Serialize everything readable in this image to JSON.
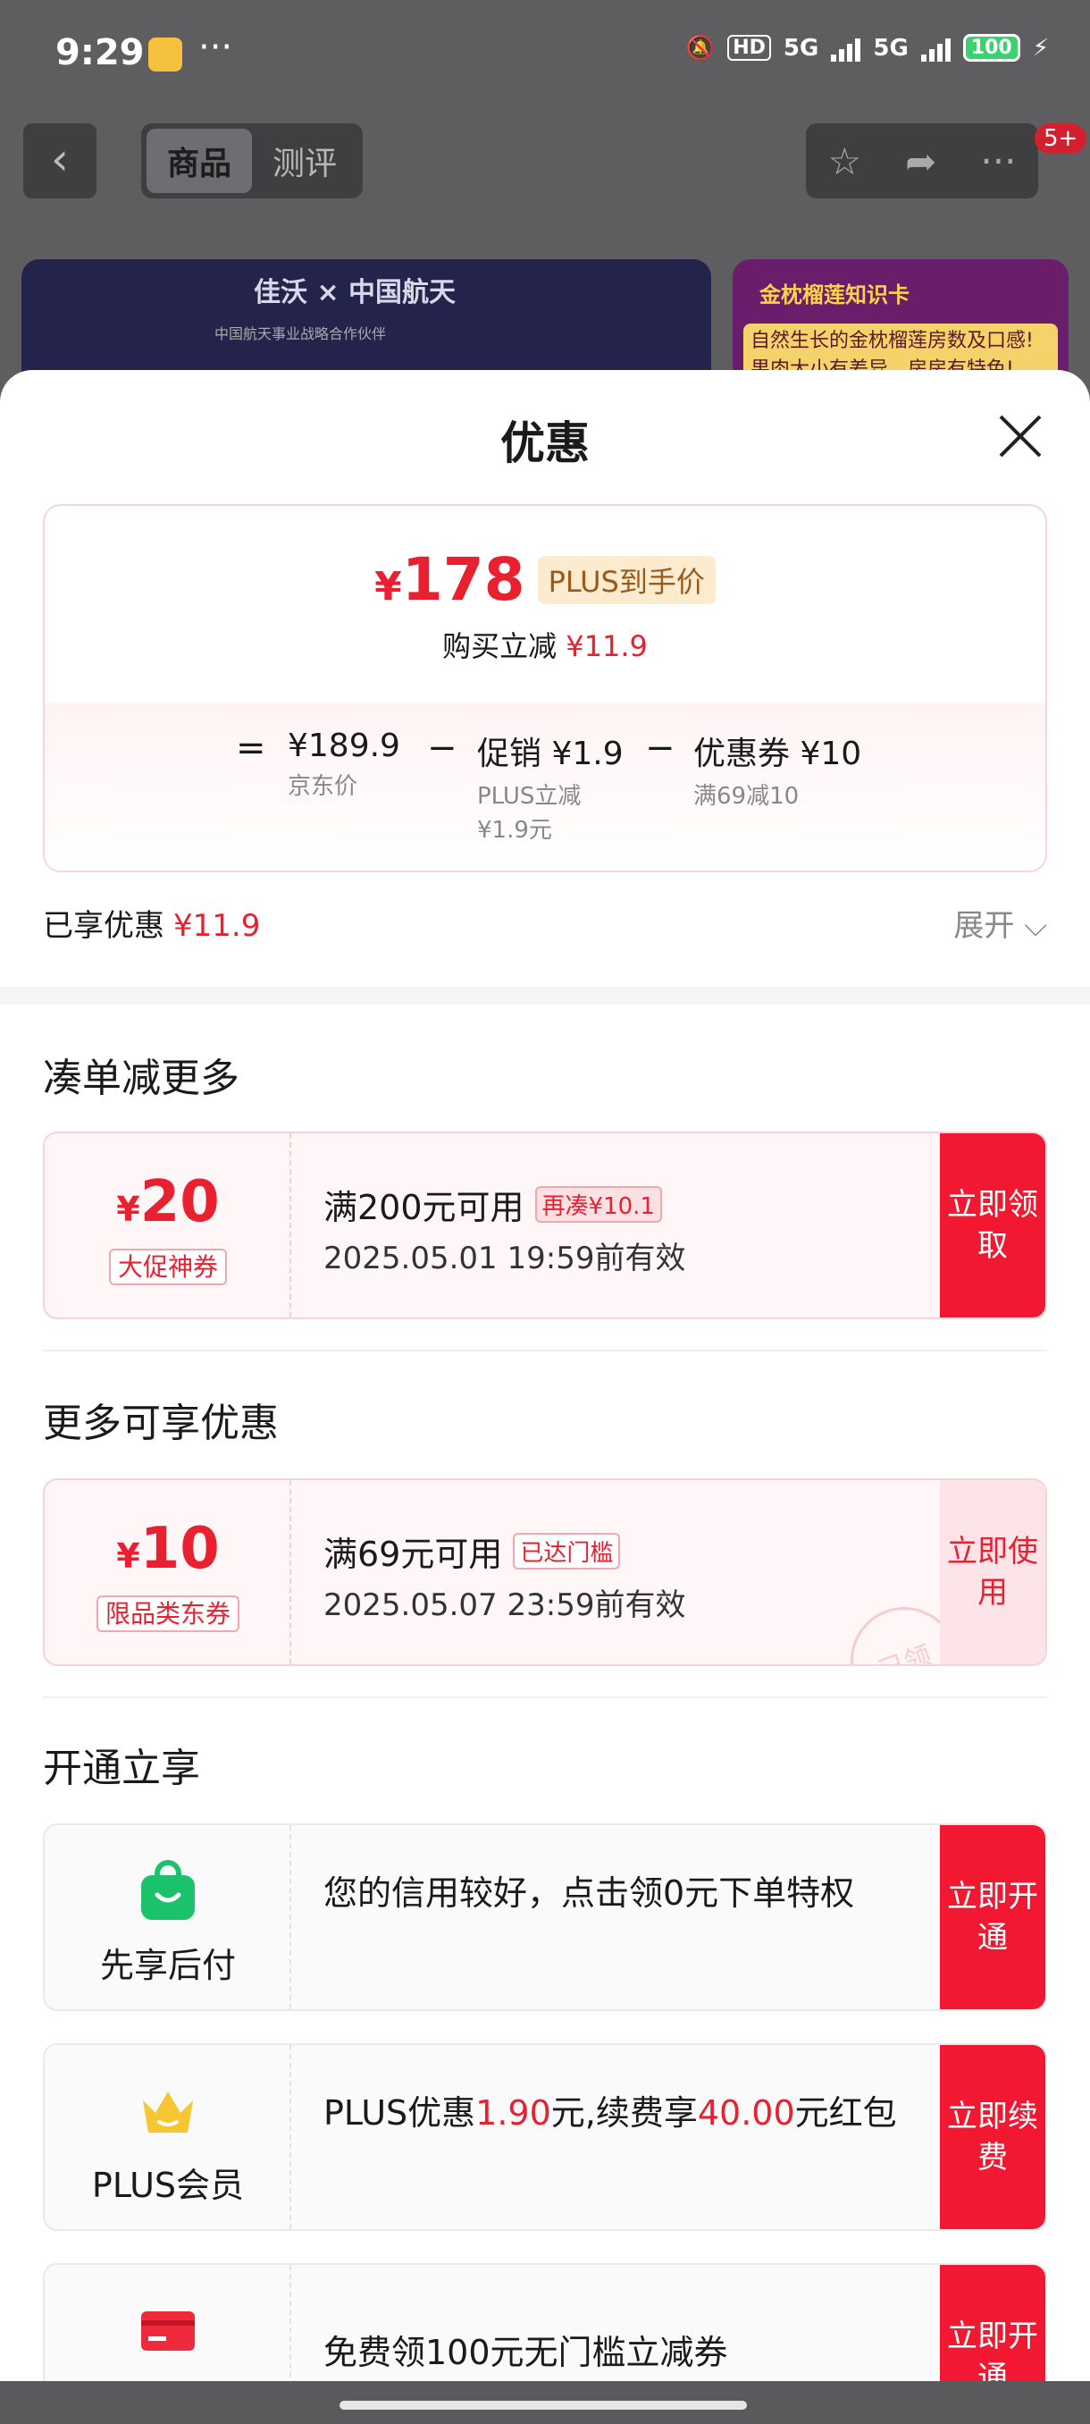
{
  "status_bar": {
    "time": "9:29",
    "dots": "···",
    "hd": "HD",
    "network1": "5G",
    "network2": "5G",
    "battery": "100"
  },
  "nav": {
    "back_icon": "‹",
    "tabs": [
      "商品",
      "测评"
    ],
    "active_tab": 0,
    "badge": "5+"
  },
  "banner_left": {
    "title": "佳沃 × 中国航天",
    "subtitle": "中国航天事业战略合作伙伴"
  },
  "banner_right": {
    "title": "金枕榴莲知识卡",
    "text": "自然生长的金枕榴莲房数及口感!果肉大小有差异、房房有特色!"
  },
  "sheet": {
    "title": "优惠",
    "price": {
      "yen": "¥",
      "value": "178",
      "tag": "PLUS到手价",
      "reduce_label": "购买立减",
      "reduce_value": "¥11.9"
    },
    "breakdown": {
      "eq": "=",
      "jd_price": "¥189.9",
      "jd_label": "京东价",
      "minus1": "−",
      "promo": "促销 ¥1.9",
      "promo_sub": "PLUS立减¥1.9元",
      "minus2": "−",
      "coupon": "优惠券 ¥10",
      "coupon_sub": "满69减10"
    },
    "enjoyed_label": "已享优惠",
    "enjoyed_value": "¥11.9",
    "expand_label": "展开 ⌵",
    "section1": "凑单减更多",
    "coupon1": {
      "yen": "¥",
      "amount": "20",
      "tag": "大促神券",
      "condition": "满200元可用",
      "cond_tag": "再凑¥10.1",
      "expire": "2025.05.01 19:59前有效",
      "action": "立即领取"
    },
    "section2": "更多可享优惠",
    "coupon2": {
      "yen": "¥",
      "amount": "10",
      "tag": "限品类东券",
      "condition": "满69元可用",
      "cond_tag": "已达门槛",
      "expire": "2025.05.07 23:59前有效",
      "action": "立即使用",
      "stamp": "已领"
    },
    "section3": "开通立享",
    "svc1": {
      "name": "先享后付",
      "text": "您的信用较好，点击领0元下单特权",
      "action": "立即开通"
    },
    "svc2": {
      "name": "PLUS会员",
      "t1": "PLUS优惠",
      "t2": "1.90",
      "t3": "元,续费享",
      "t4": "40.00",
      "t5": "元红包",
      "action": "立即续费"
    },
    "svc3": {
      "text": "免费领100元无门槛立减券",
      "action": "立即开通"
    }
  },
  "colors": {
    "accent": "#f21831",
    "price_red": "#e8202f",
    "plus_tag_bg": "#fdebd0"
  }
}
